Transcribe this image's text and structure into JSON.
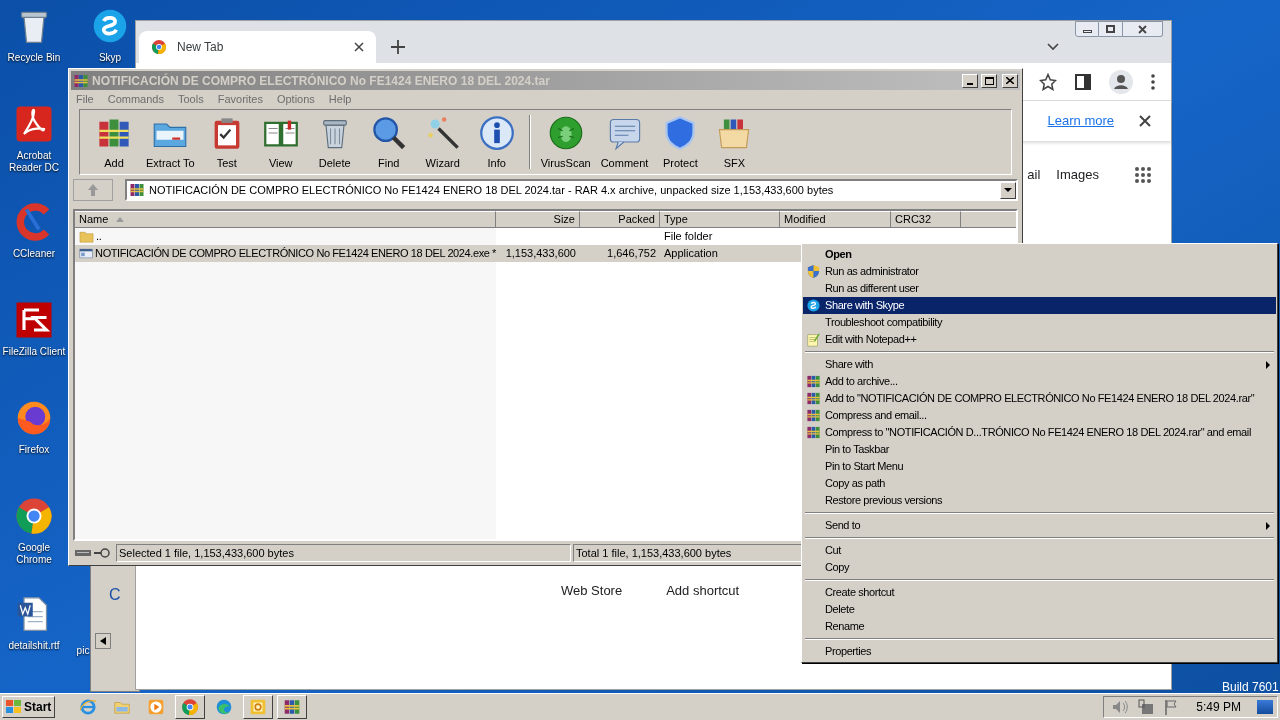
{
  "desktop_icons": [
    {
      "label": "Recycle Bin",
      "kind": "recycle"
    },
    {
      "label": "Skyp",
      "kind": "skype"
    },
    {
      "label": "Acrobat Reader DC",
      "kind": "acrobat"
    },
    {
      "label": "CCleaner",
      "kind": "ccleaner"
    },
    {
      "label": "FileZilla Client",
      "kind": "filezilla"
    },
    {
      "label": "Firefox",
      "kind": "firefox"
    },
    {
      "label": "Google Chrome",
      "kind": "chrome"
    },
    {
      "label": "detailshit.rtf",
      "kind": "word"
    },
    {
      "label": "pic",
      "kind": "none"
    }
  ],
  "os_build": "Build 7601",
  "background_window": {
    "text": "C"
  },
  "browser": {
    "tab_title": "New Tab",
    "banner_link": "Learn more",
    "top_links": [
      "ail",
      "Images"
    ],
    "shortcuts": [
      "Web Store",
      "Add shortcut"
    ]
  },
  "winrar": {
    "title": "NOTIFICACIÓN DE COMPRO ELECTRÓNICO No FE1424 ENERO 18 DEL 2024.tar",
    "menu": [
      "File",
      "Commands",
      "Tools",
      "Favorites",
      "Options",
      "Help"
    ],
    "toolbar": [
      {
        "label": "Add",
        "kind": "add"
      },
      {
        "label": "Extract To",
        "kind": "extract"
      },
      {
        "label": "Test",
        "kind": "test"
      },
      {
        "label": "View",
        "kind": "view"
      },
      {
        "label": "Delete",
        "kind": "delete"
      },
      {
        "label": "Find",
        "kind": "find"
      },
      {
        "label": "Wizard",
        "kind": "wizard"
      },
      {
        "label": "Info",
        "kind": "info"
      },
      {
        "label": "VirusScan",
        "kind": "virusscan"
      },
      {
        "label": "Comment",
        "kind": "comment"
      },
      {
        "label": "Protect",
        "kind": "protect"
      },
      {
        "label": "SFX",
        "kind": "sfx"
      }
    ],
    "address": "NOTIFICACIÓN DE COMPRO ELECTRÓNICO No FE1424 ENERO 18 DEL 2024.tar - RAR 4.x archive, unpacked size 1,153,433,600 bytes",
    "columns": [
      {
        "label": "Name",
        "sorted": true
      },
      {
        "label": "Size",
        "sorted": false
      },
      {
        "label": "Packed",
        "sorted": false
      },
      {
        "label": "Type",
        "sorted": false
      },
      {
        "label": "Modified",
        "sorted": false
      },
      {
        "label": "CRC32",
        "sorted": false
      }
    ],
    "rows": [
      {
        "kind": "folder",
        "name": "..",
        "type": "File folder",
        "selected": false
      },
      {
        "kind": "exe",
        "name": "NOTIFICACIÓN DE COMPRO ELECTRÓNICO No FE1424 ENERO 18 DEL 2024.exe *",
        "size": "1,153,433,600",
        "packed": "1,646,752",
        "type": "Application",
        "selected": true
      }
    ],
    "status_left": "Selected 1 file, 1,153,433,600 bytes",
    "status_right": "Total 1 file, 1,153,433,600 bytes"
  },
  "context_menu": {
    "items": [
      {
        "kind": "plain",
        "label": "Open",
        "bold": true,
        "selected": false,
        "submenu": false
      },
      {
        "kind": "shield",
        "label": "Run as administrator",
        "bold": false,
        "selected": false,
        "submenu": false
      },
      {
        "kind": "plain",
        "label": "Run as different user",
        "bold": false,
        "selected": false,
        "submenu": false
      },
      {
        "kind": "skype",
        "label": "Share with Skype",
        "bold": false,
        "selected": true,
        "submenu": false
      },
      {
        "kind": "plain",
        "label": "Troubleshoot compatibility",
        "bold": false,
        "selected": false,
        "submenu": false
      },
      {
        "kind": "notepad",
        "label": "Edit with Notepad++",
        "bold": false,
        "selected": false,
        "submenu": false
      },
      {
        "kind": "separator"
      },
      {
        "kind": "plain",
        "label": "Share with",
        "bold": false,
        "selected": false,
        "submenu": true
      },
      {
        "kind": "archive",
        "label": "Add to archive...",
        "bold": false,
        "selected": false,
        "submenu": false
      },
      {
        "kind": "archive",
        "label": "Add to \"NOTIFICACIÓN DE COMPRO ELECTRÓNICO No FE1424 ENERO 18 DEL 2024.rar\"",
        "bold": false,
        "selected": false,
        "submenu": false
      },
      {
        "kind": "archive",
        "label": "Compress and email...",
        "bold": false,
        "selected": false,
        "submenu": false
      },
      {
        "kind": "archive",
        "label": "Compress to \"NOTIFICACIÓN D...TRÓNICO No FE1424 ENERO 18 DEL 2024.rar\" and email",
        "bold": false,
        "selected": false,
        "submenu": false
      },
      {
        "kind": "plain",
        "label": "Pin to Taskbar",
        "bold": false,
        "selected": false,
        "submenu": false
      },
      {
        "kind": "plain",
        "label": "Pin to Start Menu",
        "bold": false,
        "selected": false,
        "submenu": false
      },
      {
        "kind": "plain",
        "label": "Copy as path",
        "bold": false,
        "selected": false,
        "submenu": false
      },
      {
        "kind": "plain",
        "label": "Restore previous versions",
        "bold": false,
        "selected": false,
        "submenu": false
      },
      {
        "kind": "separator"
      },
      {
        "kind": "plain",
        "label": "Send to",
        "bold": false,
        "selected": false,
        "submenu": true
      },
      {
        "kind": "separator"
      },
      {
        "kind": "plain",
        "label": "Cut",
        "bold": false,
        "selected": false,
        "submenu": false
      },
      {
        "kind": "plain",
        "label": "Copy",
        "bold": false,
        "selected": false,
        "submenu": false
      },
      {
        "kind": "separator"
      },
      {
        "kind": "plain",
        "label": "Create shortcut",
        "bold": false,
        "selected": false,
        "submenu": false
      },
      {
        "kind": "plain",
        "label": "Delete",
        "bold": false,
        "selected": false,
        "submenu": false
      },
      {
        "kind": "plain",
        "label": "Rename",
        "bold": false,
        "selected": false,
        "submenu": false
      },
      {
        "kind": "separator"
      },
      {
        "kind": "plain",
        "label": "Properties",
        "bold": false,
        "selected": false,
        "submenu": false
      }
    ]
  },
  "taskbar": {
    "start": "Start",
    "apps": [
      {
        "kind": "ie",
        "running": false
      },
      {
        "kind": "explorer",
        "running": false
      },
      {
        "kind": "media",
        "running": false
      },
      {
        "kind": "chrome",
        "running": true
      },
      {
        "kind": "edge",
        "running": false
      },
      {
        "kind": "outlook",
        "running": true
      },
      {
        "kind": "winrar",
        "running": true
      }
    ],
    "clock": "5:49 PM"
  }
}
